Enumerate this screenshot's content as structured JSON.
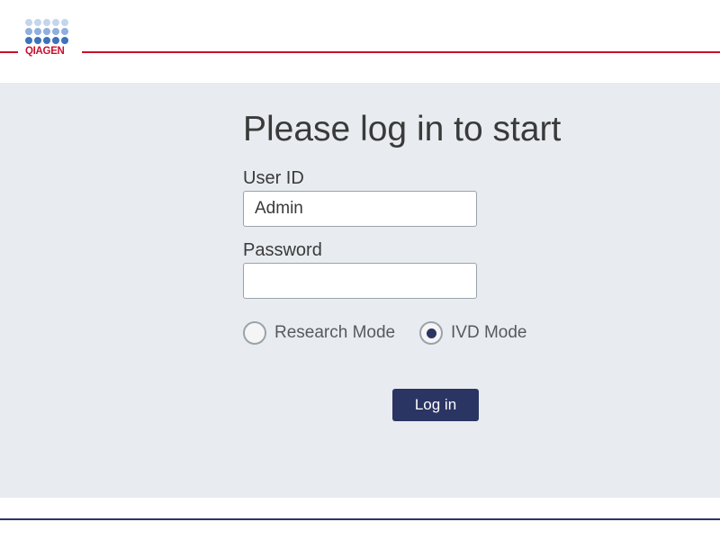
{
  "brand": {
    "logo_text": "QIAGEN",
    "accent_color": "#c8102e",
    "primary_color": "#2b3563"
  },
  "login": {
    "title": "Please log in to start",
    "user_id_label": "User ID",
    "user_id_value": "Admin",
    "password_label": "Password",
    "password_value": "",
    "modes": [
      {
        "label": "Research Mode",
        "checked": false
      },
      {
        "label": "IVD Mode",
        "checked": true
      }
    ],
    "submit_label": "Log in"
  }
}
